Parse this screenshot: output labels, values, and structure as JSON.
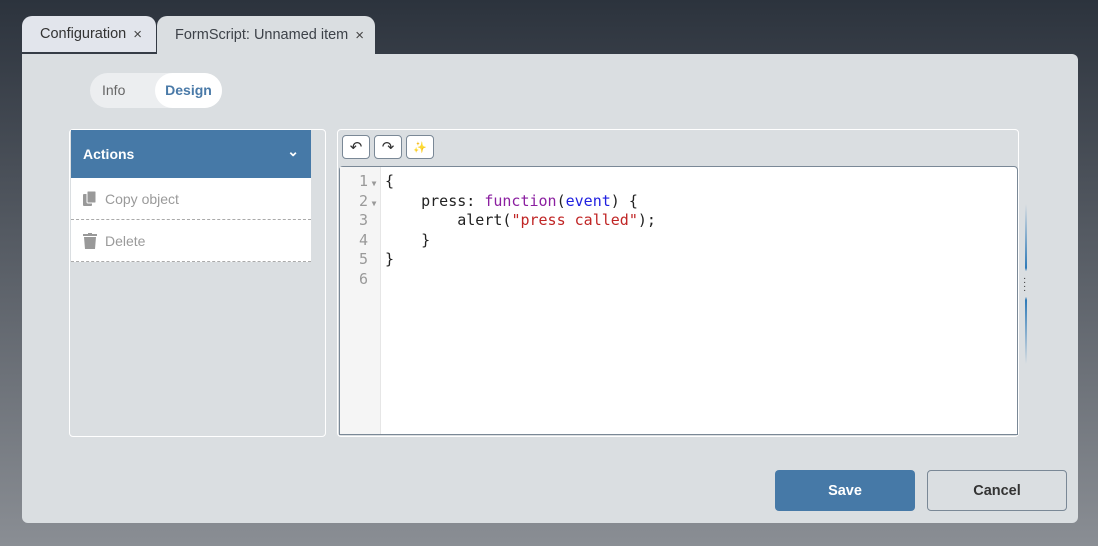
{
  "tabs": [
    {
      "label": "Configuration",
      "close": "×"
    },
    {
      "label": "FormScript: Unnamed item",
      "close": "×"
    }
  ],
  "segment": {
    "info": "Info",
    "design": "Design"
  },
  "actions": {
    "title": "Actions",
    "chevron": "⌄",
    "items": [
      {
        "label": "Copy object",
        "icon": "copy-icon"
      },
      {
        "label": "Delete",
        "icon": "trash-icon"
      }
    ]
  },
  "toolbar": {
    "undo": "↶",
    "redo": "↷",
    "beautify": "✨"
  },
  "code": {
    "line_numbers": [
      "1",
      "2",
      "3",
      "4",
      "5",
      "6"
    ],
    "lines": [
      [
        {
          "t": "{",
          "c": ""
        }
      ],
      [
        {
          "t": "    press: ",
          "c": ""
        },
        {
          "t": "function",
          "c": "kw"
        },
        {
          "t": "(",
          "c": ""
        },
        {
          "t": "event",
          "c": "var"
        },
        {
          "t": ") {",
          "c": ""
        }
      ],
      [
        {
          "t": "        alert(",
          "c": ""
        },
        {
          "t": "\"press called\"",
          "c": "str"
        },
        {
          "t": ");",
          "c": ""
        }
      ],
      [
        {
          "t": "    }",
          "c": ""
        }
      ],
      [
        {
          "t": "}",
          "c": ""
        }
      ],
      [
        {
          "t": "",
          "c": ""
        }
      ]
    ]
  },
  "buttons": {
    "save": "Save",
    "cancel": "Cancel"
  },
  "colors": {
    "accent": "#4679a7",
    "keyword": "#8b1fa0",
    "variable": "#2020e0",
    "string": "#c02525"
  }
}
